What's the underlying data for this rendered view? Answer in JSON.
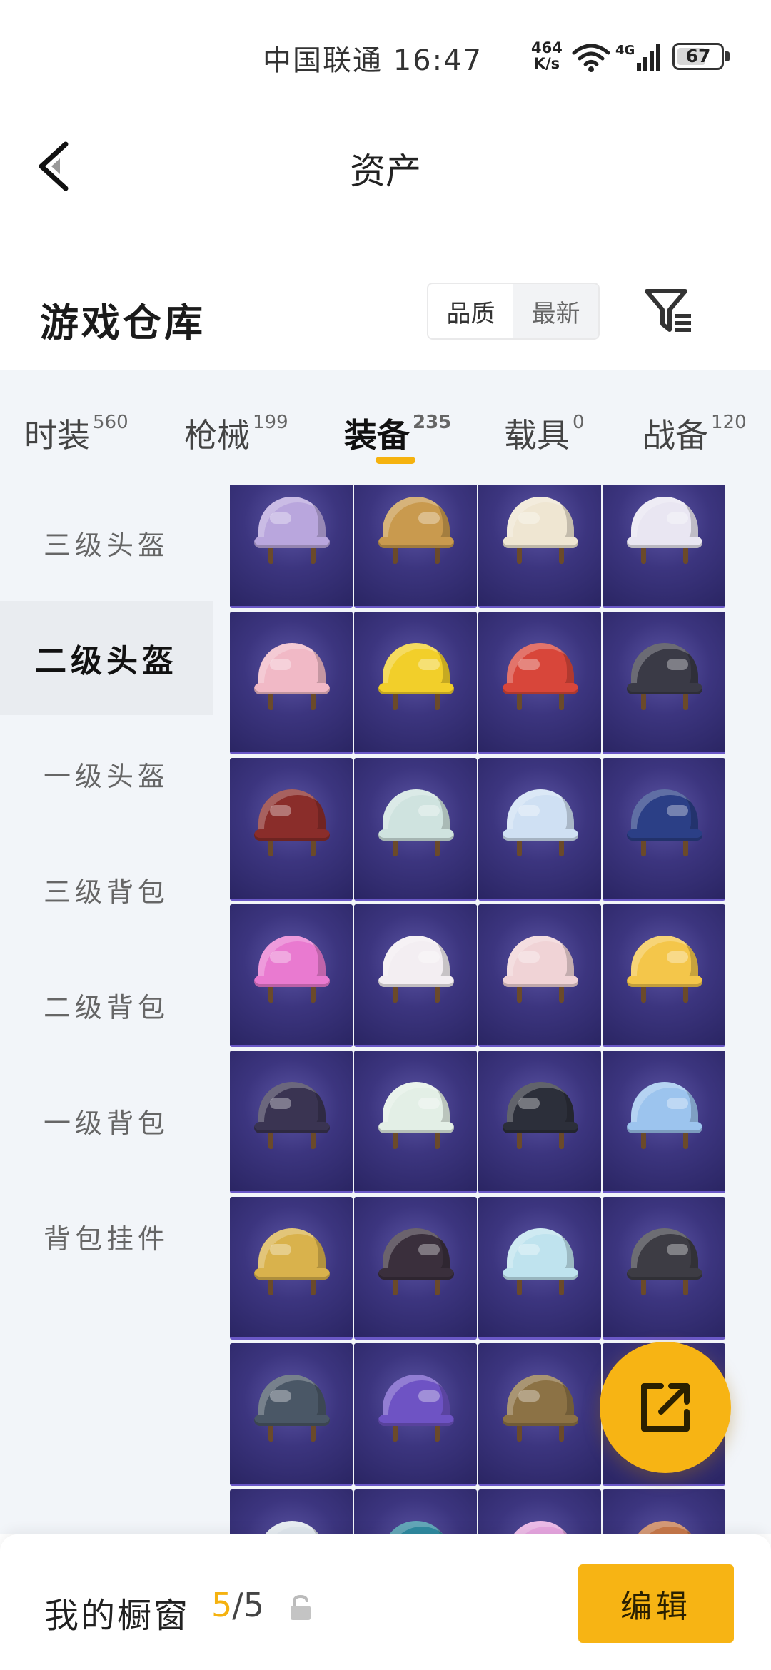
{
  "status_bar": {
    "carrier_time": "中国联通 16:47",
    "speed_value": "464",
    "speed_unit": "K/s",
    "network": "4G",
    "battery": "67",
    "battery_level": 0.67
  },
  "header": {
    "title": "资产"
  },
  "section": {
    "title": "游戏仓库",
    "sort_options": [
      "品质",
      "最新"
    ],
    "sort_active": 0
  },
  "tabs": [
    {
      "label": "时装",
      "count": "560"
    },
    {
      "label": "枪械",
      "count": "199"
    },
    {
      "label": "装备",
      "count": "235",
      "active": true
    },
    {
      "label": "载具",
      "count": "0"
    },
    {
      "label": "战备",
      "count": "120"
    }
  ],
  "sidebar": {
    "items": [
      {
        "label": "三级头盔"
      },
      {
        "label": "二级头盔",
        "active": true
      },
      {
        "label": "一级头盔"
      },
      {
        "label": "三级背包"
      },
      {
        "label": "二级背包"
      },
      {
        "label": "一级背包"
      },
      {
        "label": "背包挂件"
      }
    ]
  },
  "grid": {
    "item_names": [
      "",
      "",
      "",
      "",
      "",
      "",
      "",
      "",
      "",
      "",
      "",
      "",
      "",
      "",
      "",
      "",
      "",
      "",
      "",
      "",
      "",
      "",
      "",
      "",
      "",
      "",
      "",
      "",
      "",
      "",
      "",
      ""
    ],
    "item_colors": [
      "#b9a6dd",
      "#c99a4e",
      "#efe6d2",
      "#e9e6f2",
      "#f1b9c6",
      "#f2cf2a",
      "#d8463a",
      "#3a3a46",
      "#8a2d2a",
      "#cfe3df",
      "#cfe0f3",
      "#2b3f86",
      "#e97ad0",
      "#f3eef2",
      "#f0d3d6",
      "#f4c64a",
      "#3a3452",
      "#e3efe6",
      "#2c2f3a",
      "#9cc4ee",
      "#d9b24c",
      "#3a2f3c",
      "#bfe3ee",
      "#3d3c44",
      "#4a5766",
      "#6e53c4",
      "#8c7245",
      "#8f6bc4",
      "#dfe7ee",
      "#2f8aa0",
      "#e7a6e0",
      "#c7784a"
    ]
  },
  "bottom_bar": {
    "showcase_label": "我的橱窗",
    "showcase_used": "5",
    "showcase_total": "/5",
    "edit_label": "编辑"
  },
  "colors": {
    "accent": "#f5b20f",
    "card_bg": "#3c357f",
    "page_bg": "#f2f5f9"
  },
  "icons": {
    "back": "chevron-left-icon",
    "filter": "filter-icon",
    "share": "share-external-icon",
    "lock": "lock-icon",
    "wifi": "wifi-icon",
    "cell": "cellular-signal-icon"
  }
}
